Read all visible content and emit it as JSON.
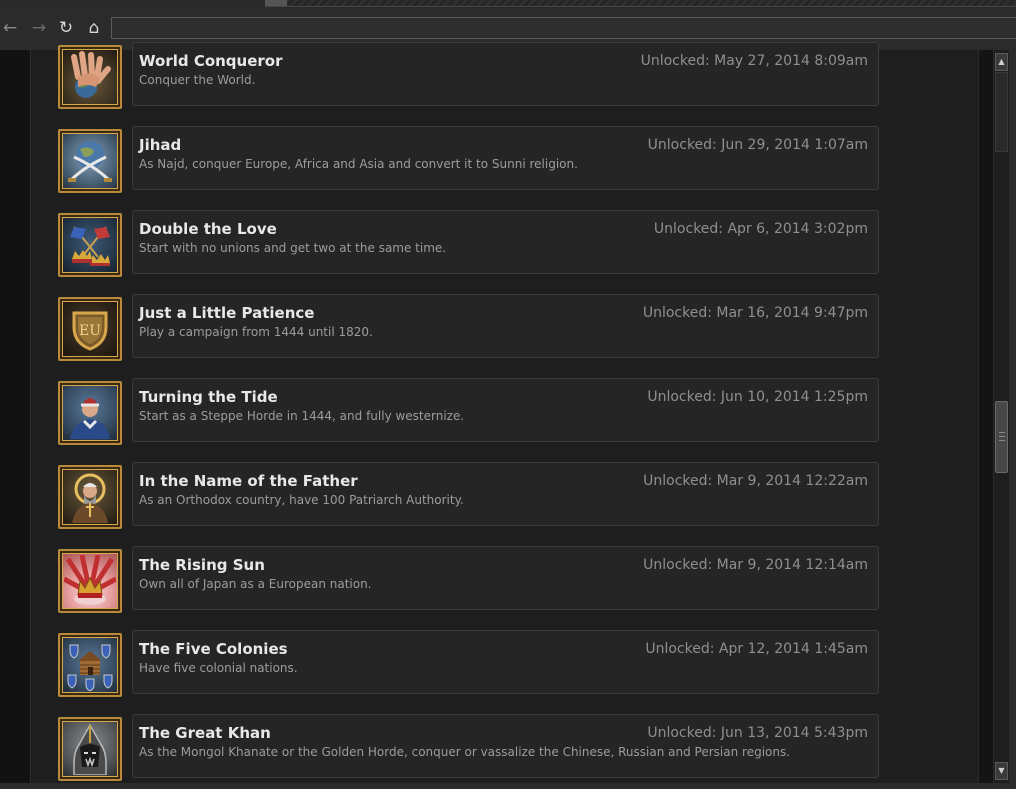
{
  "browser": {
    "back_icon": "←",
    "forward_icon": "→",
    "reload_icon": "↻",
    "home_icon": "⌂",
    "url": ""
  },
  "achievements": [
    {
      "title": "World Conqueror",
      "description": "Conquer the World.",
      "unlocked": "Unlocked: May 27, 2014 8:09am",
      "icon": "hand-globe-icon"
    },
    {
      "title": "Jihad",
      "description": "As Najd, conquer Europe, Africa and Asia and convert it to Sunni religion.",
      "unlocked": "Unlocked: Jun 29, 2014 1:07am",
      "icon": "globe-crossed-swords-icon"
    },
    {
      "title": "Double the Love",
      "description": "Start with no unions and get two at the same time.",
      "unlocked": "Unlocked: Apr 6, 2014 3:02pm",
      "icon": "crossed-flags-crowns-icon"
    },
    {
      "title": "Just a Little Patience",
      "description": "Play a campaign from 1444 until 1820.",
      "unlocked": "Unlocked: Mar 16, 2014 9:47pm",
      "icon": "eu-shield-icon"
    },
    {
      "title": "Turning the Tide",
      "description": "Start as a Steppe Horde in 1444, and fully westernize.",
      "unlocked": "Unlocked: Jun 10, 2014 1:25pm",
      "icon": "turbaned-noble-icon"
    },
    {
      "title": "In the Name of the Father",
      "description": "As an Orthodox country, have 100 Patriarch Authority.",
      "unlocked": "Unlocked: Mar 9, 2014 12:22am",
      "icon": "patriarch-icon"
    },
    {
      "title": "The Rising Sun",
      "description": "Own all of Japan as a European nation.",
      "unlocked": "Unlocked: Mar 9, 2014 12:14am",
      "icon": "rising-sun-crown-icon"
    },
    {
      "title": "The Five Colonies",
      "description": "Have five colonial nations.",
      "unlocked": "Unlocked: Apr 12, 2014 1:45am",
      "icon": "colony-shields-icon"
    },
    {
      "title": "The Great Khan",
      "description": "As the Mongol Khanate or the Golden Horde, conquer or vassalize the Chinese, Russian and Persian regions.",
      "unlocked": "Unlocked: Jun 13, 2014 5:43pm",
      "icon": "khan-helmet-icon"
    }
  ],
  "scrollbar": {
    "up_icon": "▲",
    "down_icon": "▼",
    "position": 0.5
  },
  "colors": {
    "background": "#1e1e1e",
    "card": "#252525",
    "card_border": "#3c3c3c",
    "title": "#e8e8e8",
    "description": "#9c9c9c",
    "unlock_text": "#8f8f8f",
    "icon_frame": "#b88a3a"
  }
}
